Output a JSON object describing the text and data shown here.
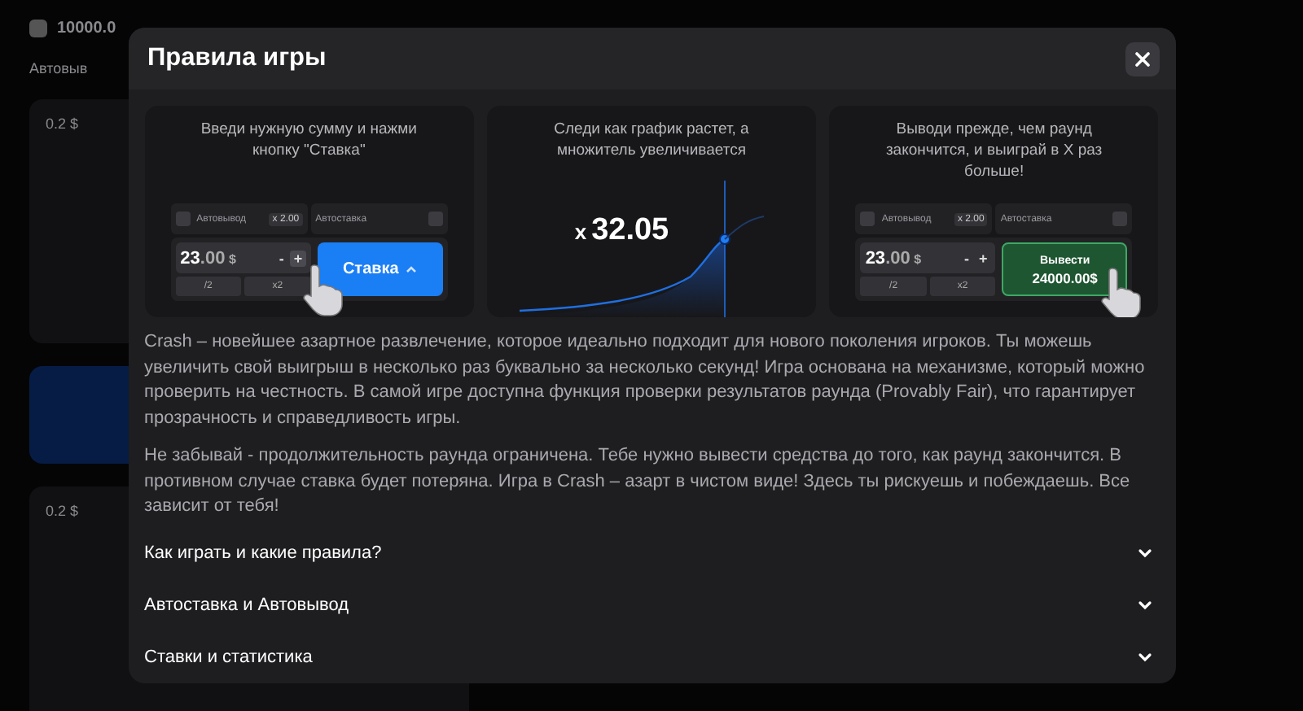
{
  "background": {
    "balance": "10000.0",
    "autocashout_label": "Автовыв",
    "bets": [
      {
        "amount": "0.2 $"
      },
      {
        "amount": "0.2 $"
      }
    ]
  },
  "modal": {
    "title": "Правила игры",
    "steps": [
      {
        "kind": "bet",
        "caption": "Введи нужную сумму и нажми кнопку \"Ставка\"",
        "autocashout": "Автовывод",
        "autocashout_checked": false,
        "multiplier": "x 2.00",
        "autobet": "Автоставка",
        "autobet_checked": false,
        "amount_int": "23",
        "amount_dec": ".00",
        "currency": "$",
        "minus": "-",
        "plus": "+",
        "half": "/2",
        "double": "x2",
        "action": "Ставка"
      },
      {
        "kind": "chart",
        "caption": "Следи как график растет, а множитель увеличивается",
        "prefix": "x",
        "value": "32.05"
      },
      {
        "kind": "cashout",
        "caption": "Выводи прежде, чем раунд закончится, и выиграй в X раз больше!",
        "autocashout": "Автовывод",
        "autocashout_checked": false,
        "multiplier": "x 2.00",
        "autobet": "Автоставка",
        "autobet_checked": false,
        "amount_int": "23",
        "amount_dec": ".00",
        "currency": "$",
        "minus": "-",
        "plus": "+",
        "half": "/2",
        "double": "x2",
        "action": "Вывести",
        "action_sub": "24000.00$"
      }
    ],
    "paragraphs": [
      "Crash – новейшее азартное развлечение, которое идеально подходит для нового поколения игроков. Ты можешь увеличить свой выигрыш в несколько раз буквально за несколько секунд! Игра основана на механизме, который можно проверить на честность. В самой игре доступна функция проверки результатов раунда (Provably Fair), что гарантирует прозрачность и справедливость игры.",
      "Не забывай - продолжительность раунда ограничена. Тебе нужно вывести средства до того, как раунд закончится. В противном случае ставка будет потеряна. Игра в Crash – азарт в чистом виде! Здесь ты рискуешь и побеждаешь. Все зависит от тебя!"
    ],
    "sections": [
      {
        "title": "Как играть и какие правила?",
        "expanded": false
      },
      {
        "title": "Автоставка и Автовывод",
        "expanded": false
      },
      {
        "title": "Ставки и статистика",
        "expanded": false
      }
    ]
  }
}
